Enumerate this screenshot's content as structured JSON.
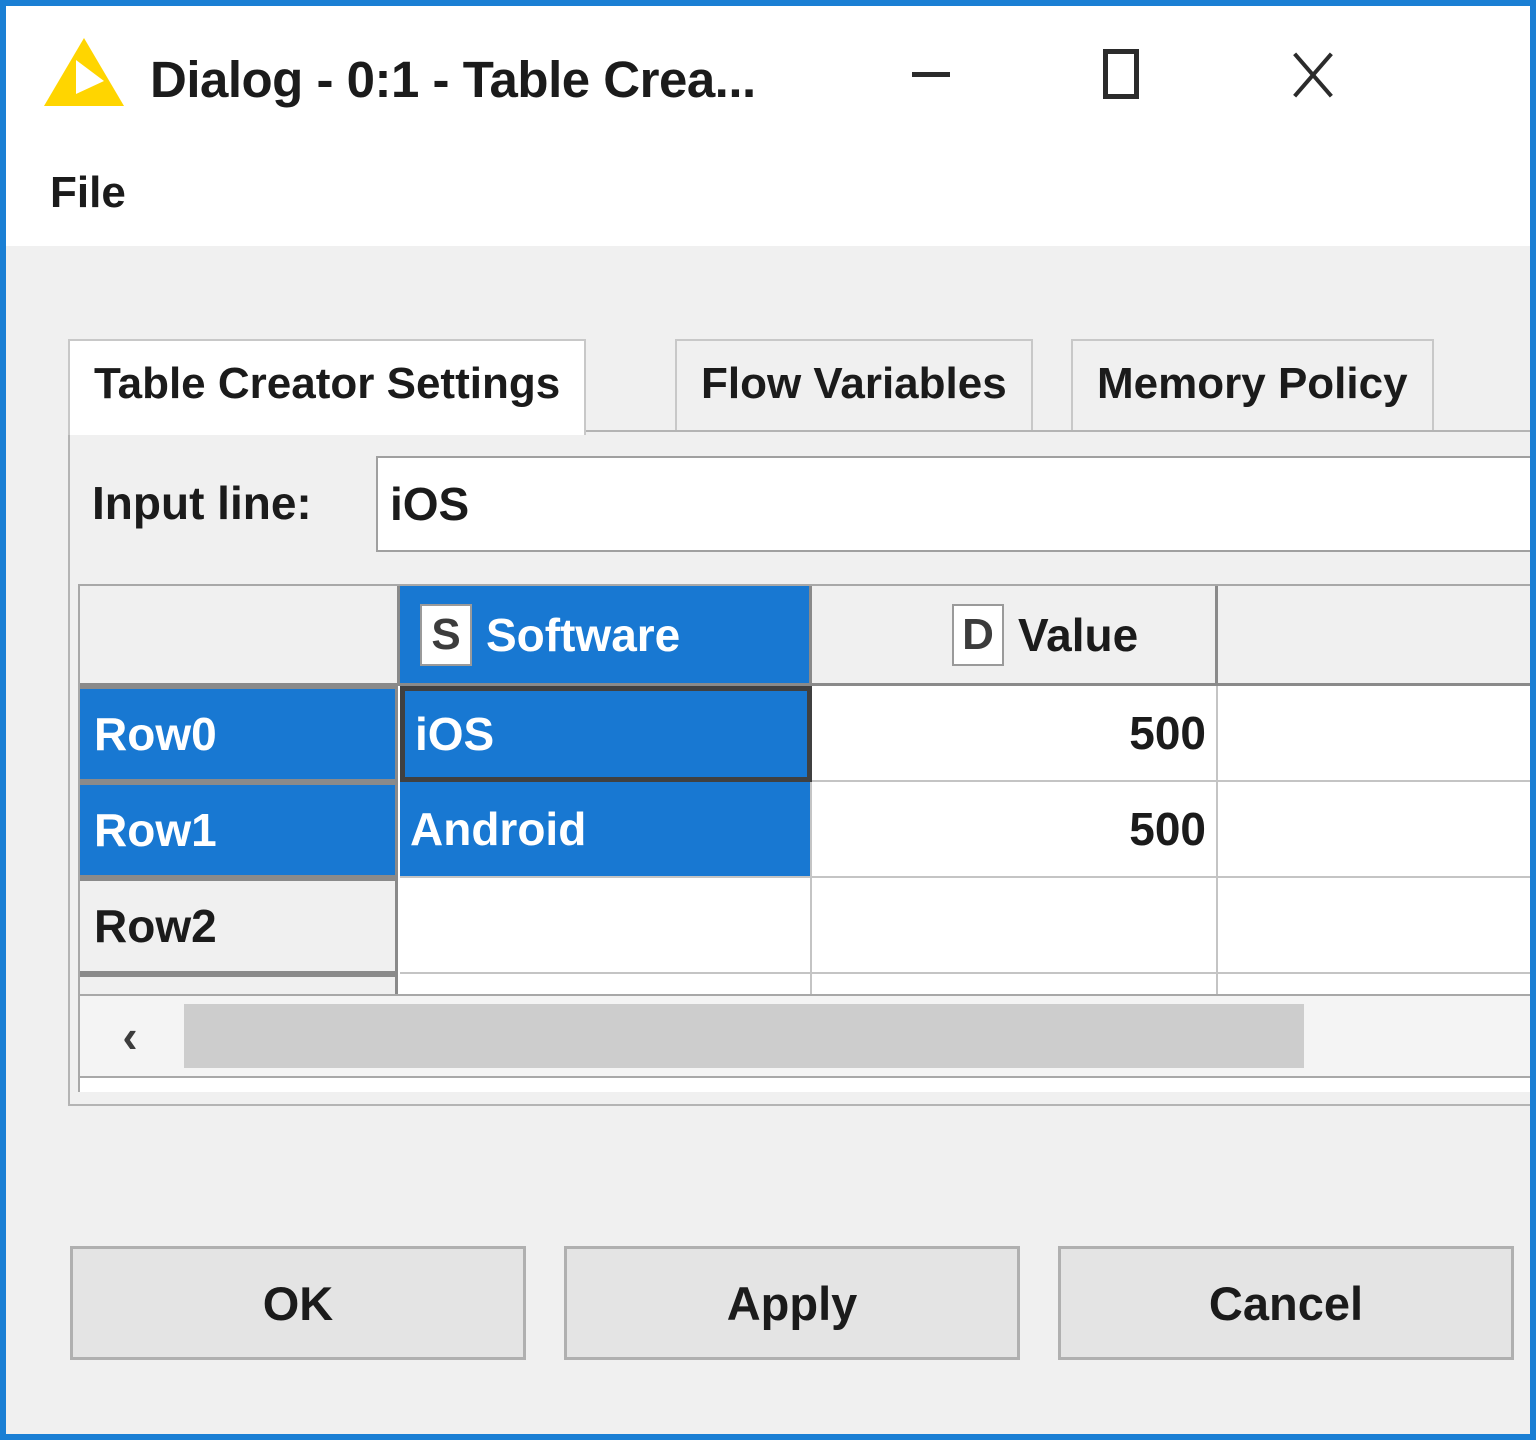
{
  "window": {
    "title": "Dialog - 0:1 - Table Crea...",
    "app_icon": "knime-triangle-icon",
    "accent_border_color": "#1a7fd4",
    "controls": {
      "minimize_label": "Minimize",
      "maximize_label": "Maximize",
      "close_label": "Close"
    }
  },
  "menubar": {
    "items": [
      {
        "label": "File"
      }
    ]
  },
  "tabs": [
    {
      "label": "Table Creator Settings",
      "active": true
    },
    {
      "label": "Flow Variables",
      "active": false
    },
    {
      "label": "Memory Policy",
      "active": false
    }
  ],
  "settings": {
    "input_line": {
      "label": "Input line:",
      "value": "iOS",
      "placeholder": ""
    }
  },
  "table": {
    "columns": [
      {
        "type_badge": "",
        "title": "",
        "selected": false,
        "is_rowheader": true
      },
      {
        "type_badge": "S",
        "title": "Software",
        "selected": true
      },
      {
        "type_badge": "D",
        "title": "Value",
        "selected": false
      },
      {
        "type_badge": "",
        "title": "",
        "selected": false
      }
    ],
    "rows": [
      {
        "header": "Row0",
        "header_selected": true,
        "cells": [
          {
            "value": "iOS",
            "selected": true,
            "focused": true,
            "align": "left"
          },
          {
            "value": "500",
            "selected": false,
            "focused": false,
            "align": "right"
          },
          {
            "value": "",
            "selected": false,
            "focused": false,
            "align": "left"
          }
        ]
      },
      {
        "header": "Row1",
        "header_selected": true,
        "cells": [
          {
            "value": "Android",
            "selected": true,
            "focused": false,
            "align": "left"
          },
          {
            "value": "500",
            "selected": false,
            "focused": false,
            "align": "right"
          },
          {
            "value": "",
            "selected": false,
            "focused": false,
            "align": "left"
          }
        ]
      },
      {
        "header": "Row2",
        "header_selected": false,
        "cells": [
          {
            "value": "",
            "selected": false,
            "focused": false,
            "align": "left"
          },
          {
            "value": "",
            "selected": false,
            "focused": false,
            "align": "right"
          },
          {
            "value": "",
            "selected": false,
            "focused": false,
            "align": "left"
          }
        ]
      },
      {
        "header": "",
        "header_selected": false,
        "cells": [
          {
            "value": "",
            "selected": false,
            "focused": false,
            "align": "left"
          },
          {
            "value": "",
            "selected": false,
            "focused": false,
            "align": "right"
          },
          {
            "value": "",
            "selected": false,
            "focused": false,
            "align": "left"
          }
        ]
      }
    ]
  },
  "scrollbar": {
    "left_arrow_glyph": "‹",
    "orientation": "horizontal"
  },
  "buttons": {
    "ok": "OK",
    "apply": "Apply",
    "cancel": "Cancel"
  },
  "colors": {
    "selection_blue": "#1878d2",
    "window_chrome": "#f0f0f0",
    "knime_yellow": "#ffd500"
  }
}
